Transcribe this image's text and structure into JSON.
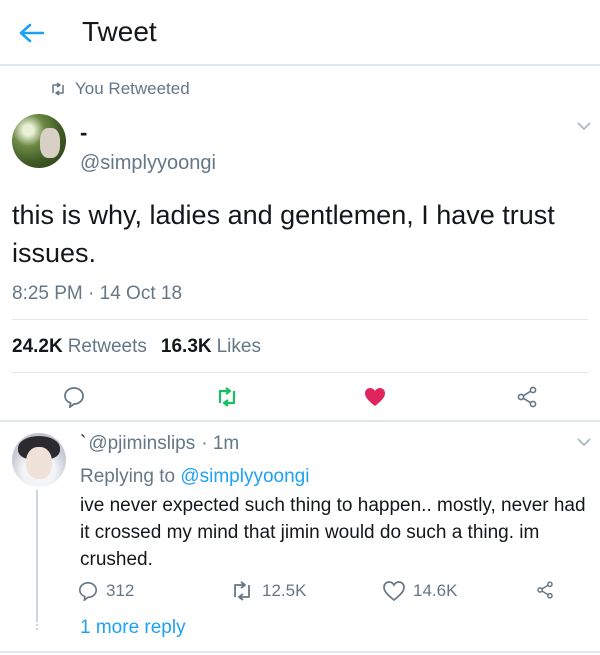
{
  "header": {
    "title": "Tweet",
    "back_icon": "arrow-left-icon"
  },
  "retweet_notice": {
    "label": "You Retweeted",
    "icon": "retweet-icon"
  },
  "tweet": {
    "name": "-",
    "handle": "@simplyyoongi",
    "text": "this is why, ladies and gentlemen, I have trust issues.",
    "timestamp": "8:25 PM · 14 Oct 18",
    "retweets_count": "24.2K",
    "retweets_label": "Retweets",
    "likes_count": "16.3K",
    "likes_label": "Likes",
    "liked": true,
    "retweeted": true,
    "colors": {
      "retweet_active": "#17bf63",
      "like_active": "#e0245e",
      "accent": "#1da1f2"
    }
  },
  "reply": {
    "name": "`",
    "handle": "@pjiminslips",
    "time": "· 1m",
    "replying_prefix": "Replying to",
    "replying_to": "@simplyyoongi",
    "text": "ive never expected such thing to happen.. mostly, never had it crossed my mind that jimin would do such a thing. im crushed.",
    "reply_count": "312",
    "retweet_count": "12.5K",
    "like_count": "14.6K",
    "more_replies": "1 more reply"
  }
}
